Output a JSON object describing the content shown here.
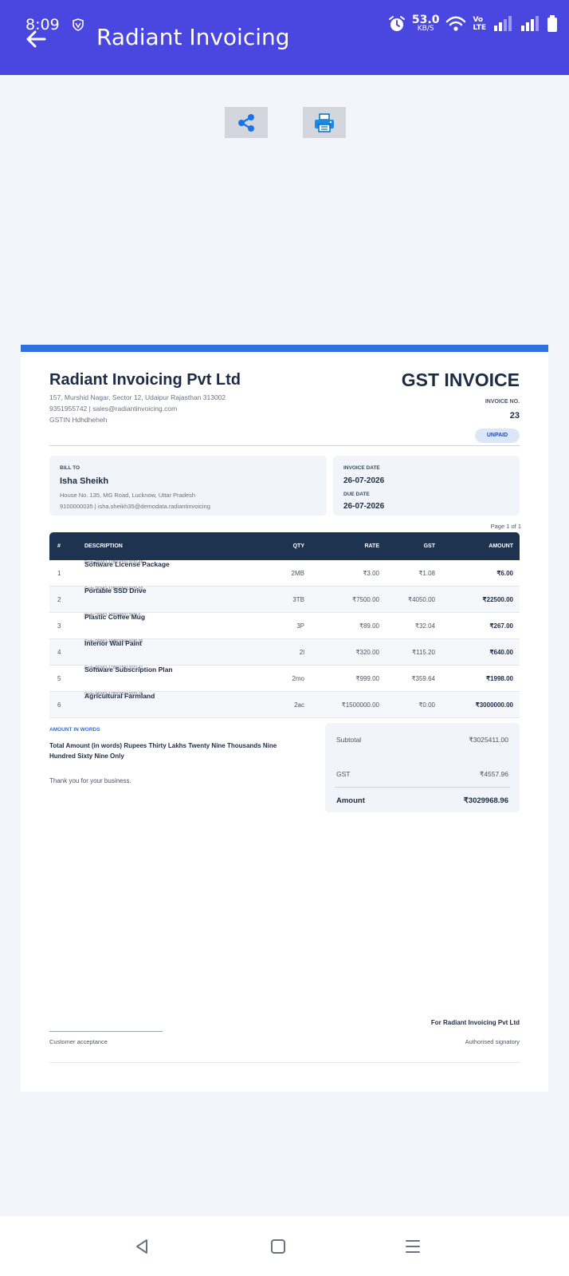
{
  "status_bar": {
    "time": "8:09",
    "net_speed_value": "53.0",
    "net_speed_unit": "KB/S",
    "network_line1": "Vo",
    "network_line2": "LTE"
  },
  "app_bar": {
    "title": "Radiant Invoicing"
  },
  "actions": {
    "share_icon": "share-icon",
    "print_icon": "print-icon"
  },
  "invoice": {
    "company_name": "Radiant Invoicing Pvt Ltd",
    "doc_title": "GST INVOICE",
    "address": "157, Murshid Nagar, Sector 12, Udaipur Rajasthan 313002",
    "contact": "9351955742  |  sales@radiantinvoicing.com",
    "gstin": "GSTIN  Hdhdheheh",
    "invoice_no_label": "INVOICE NO.",
    "invoice_no": "23",
    "status": "UNPAID",
    "bill_to_label": "BILL TO",
    "client_name": "Isha Sheikh",
    "client_address": "House No. 135, MG Road, Lucknow, Uttar Pradesh",
    "client_contact": "9100000035  |  isha.sheikh35@demodata.radiantinvoicing",
    "invoice_date_label": "INVOICE DATE",
    "invoice_date": "26-07-2026",
    "due_date_label": "DUE DATE",
    "due_date": "26-07-2026",
    "page_info": "Page 1 of 1",
    "columns": {
      "idx": "#",
      "description": "DESCRIPTION",
      "qty": "QTY",
      "rate": "RATE",
      "gst": "GST",
      "amount": "AMOUNT"
    },
    "items": [
      {
        "idx": "1",
        "name": "Software License Package",
        "code": "Code DEMO-1785075913070-49",
        "qty": "2MB",
        "rate": "₹3.00",
        "gst": "₹1.08",
        "amount": "₹6.00"
      },
      {
        "idx": "2",
        "name": "Portable SSD Drive",
        "code": "Code DEMO-1785075913070-50",
        "qty": "3TB",
        "rate": "₹7500.00",
        "gst": "₹4050.00",
        "amount": "₹22500.00"
      },
      {
        "idx": "3",
        "name": "Plastic Coffee Mug",
        "code": "Code DEMO-1785075913070-6",
        "qty": "3P",
        "rate": "₹89.00",
        "gst": "₹32.04",
        "amount": "₹267.00"
      },
      {
        "idx": "4",
        "name": "Interior Wall Paint",
        "code": "Code DEMO-1785075913070-36",
        "qty": "2l",
        "rate": "₹320.00",
        "gst": "₹115.20",
        "amount": "₹640.00"
      },
      {
        "idx": "5",
        "name": "Software Subscription Plan",
        "code": "Code DEMO-1785075913070-41",
        "qty": "2mo",
        "rate": "₹999.00",
        "gst": "₹359.64",
        "amount": "₹1998.00"
      },
      {
        "idx": "6",
        "name": "Agricultural Farmland",
        "code": "Code DEMO-1785075913070-35",
        "qty": "2ac",
        "rate": "₹1500000.00",
        "gst": "₹0.00",
        "amount": "₹3000000.00"
      }
    ],
    "amount_in_words_label": "AMOUNT IN WORDS",
    "amount_in_words": "Total Amount (in words) Rupees Thirty Lakhs Twenty Nine Thousands Nine Hundred Sixty Nine Only",
    "thanks": "Thank you for your business.",
    "subtotal_label": "Subtotal",
    "subtotal": "₹3025411.00",
    "gst_label": "GST",
    "gst_total": "₹4557.96",
    "amount_label": "Amount",
    "amount_total": "₹3029968.96",
    "customer_acceptance": "Customer acceptance",
    "for_company": "For Radiant Invoicing Pvt Ltd",
    "authorised_signatory": "Authorised signatory"
  },
  "nav_bar": {
    "back_icon": "triangle-back-icon",
    "home_icon": "square-home-icon",
    "recents_icon": "menu-recents-icon"
  },
  "colors": {
    "app_bar": "#4a47e0",
    "accent": "#2f6fe0",
    "table_header": "#1e3350"
  }
}
